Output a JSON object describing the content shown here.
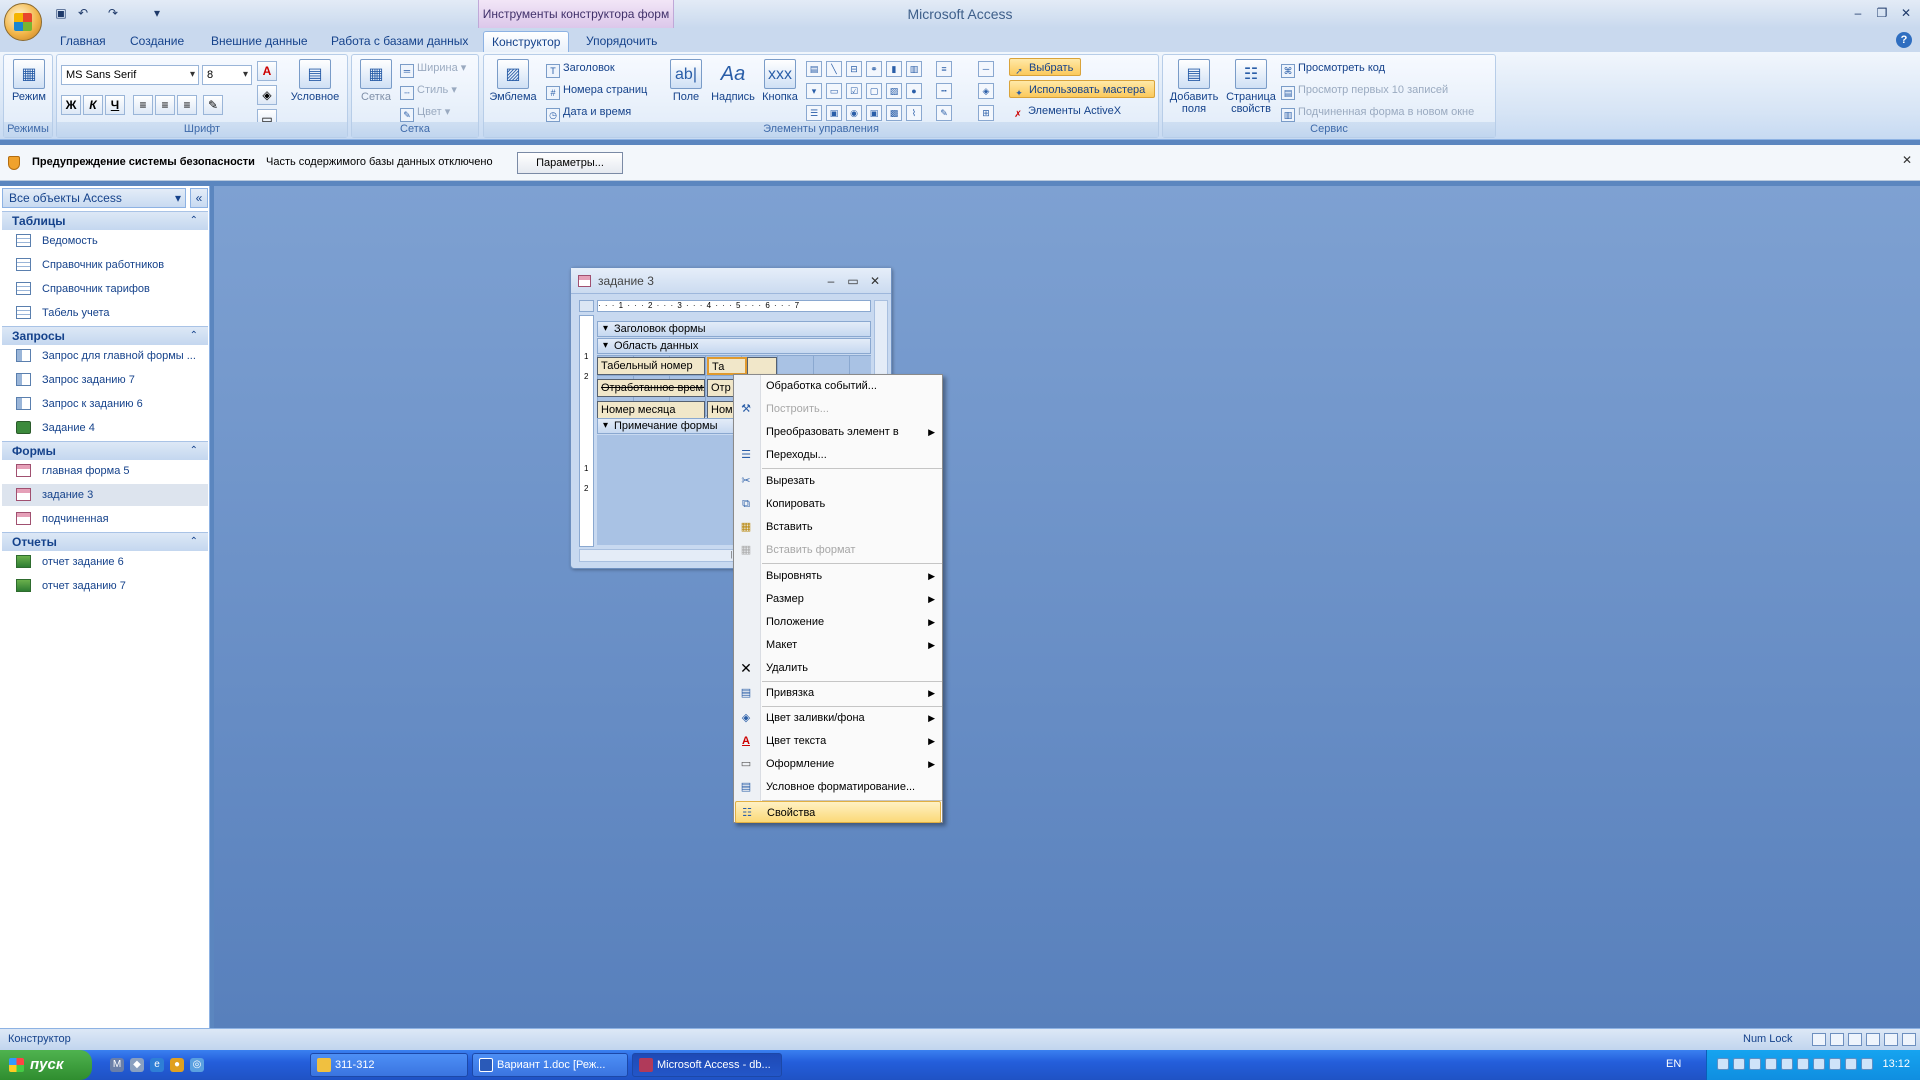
{
  "window": {
    "app_title": "Microsoft Access",
    "context_tab_title": "Инструменты конструктора форм"
  },
  "tabs": [
    "Главная",
    "Создание",
    "Внешние данные",
    "Работа с базами данных",
    "Конструктор",
    "Упорядочить"
  ],
  "ribbon": {
    "groups": {
      "modes": "Режимы",
      "font": "Шрифт",
      "grid": "Сетка",
      "controls": "Элементы управления",
      "service": "Сервис"
    },
    "mode_btn": "Режим",
    "font_name": "MS Sans Serif",
    "font_size": "8",
    "bold": "Ж",
    "italic": "К",
    "underline": "Ч",
    "conditional_btn": "Условное",
    "grid_btn": "Сетка",
    "width_btn": "Ширина",
    "style_btn": "Стиль",
    "color_btn": "Цвет",
    "logo_btn": "Эмблема",
    "title_btn": "Заголовок",
    "page_numbers_btn": "Номера страниц",
    "date_time_btn": "Дата и время",
    "field_btn": "Поле",
    "label_btn": "Надпись",
    "button_btn": "Кнопка",
    "select_btn": "Выбрать",
    "wizard_btn": "Использовать мастера",
    "activex_btn": "Элементы ActiveX",
    "add_fields_btn_1": "Добавить",
    "add_fields_btn_2": "поля",
    "property_sheet_btn_1": "Страница",
    "property_sheet_btn_2": "свойств",
    "view_code_btn": "Просмотреть код",
    "view_first10_btn": "Просмотр первых 10 записей",
    "subform_new_window_btn": "Подчиненная форма в новом окне"
  },
  "security_bar": {
    "title": "Предупреждение системы безопасности",
    "message": "Часть содержимого базы данных отключено",
    "button": "Параметры..."
  },
  "nav": {
    "header": "Все объекты Access",
    "groups": [
      {
        "title": "Таблицы",
        "items": [
          "Ведомость",
          "Справочник работников",
          "Справочник тарифов",
          "Табель учета"
        ]
      },
      {
        "title": "Запросы",
        "items": [
          "Запрос для главной формы ...",
          "Запрос заданию 7",
          "Запрос к заданию 6",
          "Задание 4"
        ]
      },
      {
        "title": "Формы",
        "items": [
          "главная форма 5",
          "задание 3",
          "подчиненная"
        ]
      },
      {
        "title": "Отчеты",
        "items": [
          "отчет задание 6",
          "отчет заданию 7"
        ]
      }
    ]
  },
  "form_window": {
    "title": "задание 3",
    "ruler": "· · · 1 · · · 2 · · · 3 · · · 4 · · · 5 · · · 6 · · · 7",
    "header_section": "Заголовок формы",
    "detail_section": "Область данных",
    "footer_section": "Примечание формы",
    "controls": {
      "label_1": "Табельный номер",
      "field_1": "Та",
      "label_2": "Отработанное время",
      "field_2": "Отр",
      "label_3": "Номер месяца",
      "field_3": "Ном"
    }
  },
  "context_menu": {
    "events": "Обработка событий...",
    "build": "Построить...",
    "change_to": "Преобразовать элемент в",
    "tab_order": "Переходы...",
    "cut": "Вырезать",
    "copy": "Копировать",
    "paste": "Вставить",
    "paste_format": "Вставить формат",
    "align": "Выровнять",
    "size": "Размер",
    "position": "Положение",
    "layout": "Макет",
    "delete": "Удалить",
    "anchoring": "Привязка",
    "fill_color": "Цвет заливки/фона",
    "font_color": "Цвет текста",
    "special_effect": "Оформление",
    "conditional_format": "Условное форматирование...",
    "properties": "Свойства"
  },
  "status_bar": {
    "mode": "Конструктор",
    "numlock": "Num Lock"
  },
  "taskbar": {
    "start": "пуск",
    "tasks": [
      "311-312",
      "Вариант 1.doc [Реж...",
      "Microsoft Access - db..."
    ],
    "lang": "EN",
    "clock": "13:12"
  }
}
